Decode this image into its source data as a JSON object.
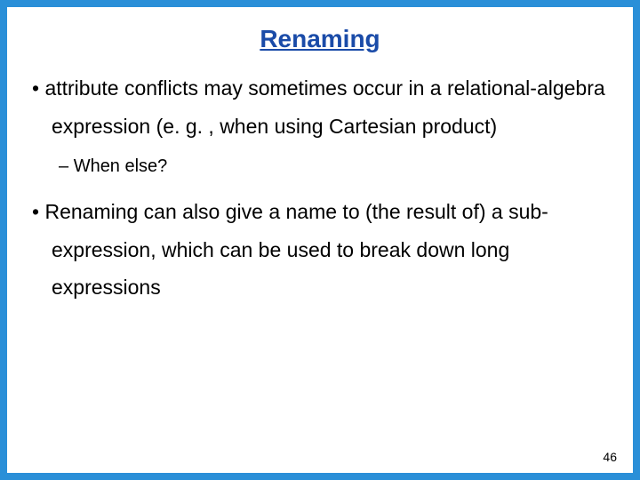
{
  "title": "Renaming",
  "bullets": [
    {
      "level": 1,
      "text": "attribute conflicts may sometimes occur in a relational-algebra expression (e. g. , when using Cartesian product)"
    },
    {
      "level": 2,
      "text": "When else?"
    },
    {
      "level": 1,
      "text": "Renaming can also give a name to (the result of) a sub-expression, which can be used to break down long expressions"
    }
  ],
  "page_number": "46"
}
